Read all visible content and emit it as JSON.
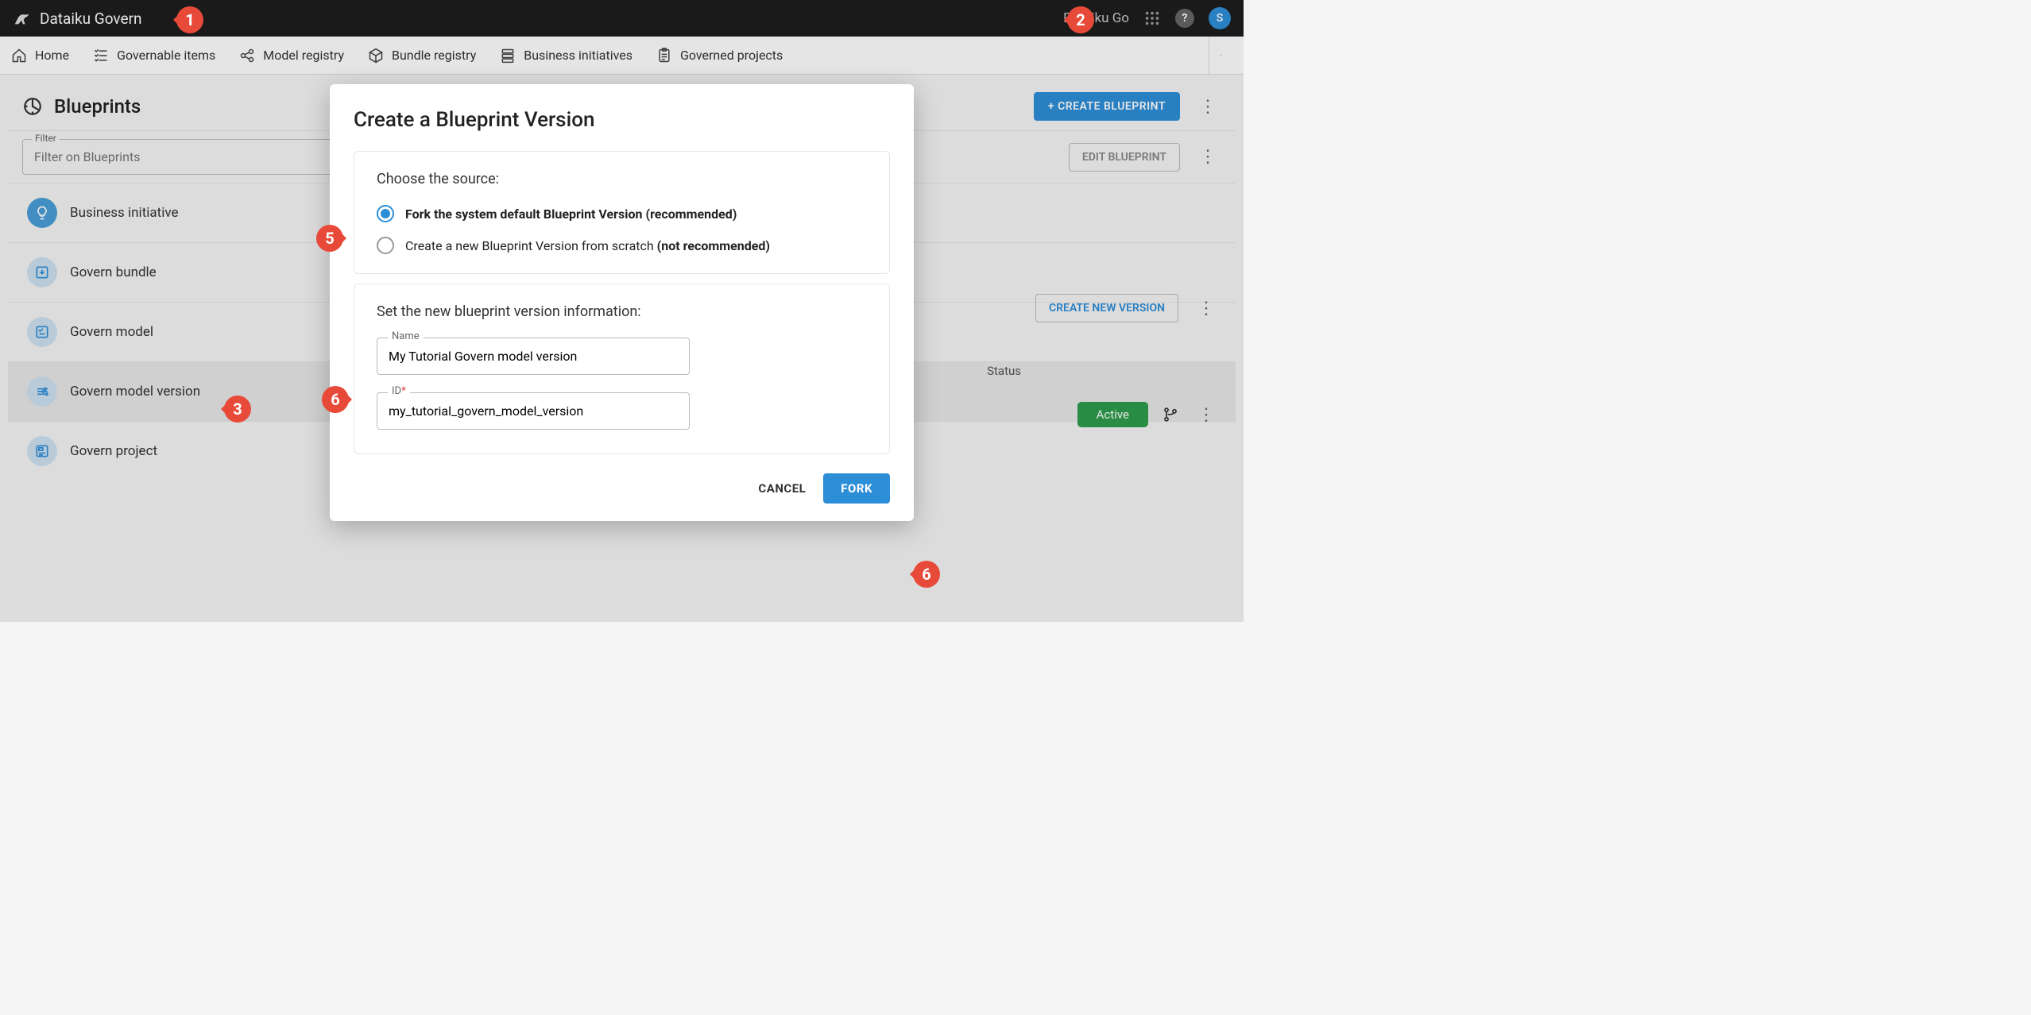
{
  "topbar": {
    "app_title": "Dataiku Govern",
    "tenant": "Dataiku Go",
    "avatar_initial": "S"
  },
  "nav": {
    "items": [
      {
        "label": "Home"
      },
      {
        "label": "Governable items"
      },
      {
        "label": "Model registry"
      },
      {
        "label": "Bundle registry"
      },
      {
        "label": "Business initiatives"
      },
      {
        "label": "Governed projects"
      }
    ]
  },
  "page": {
    "title": "Blueprints",
    "create_btn": "+ CREATE BLUEPRINT",
    "filter_label": "Filter",
    "filter_placeholder": "Filter on Blueprints",
    "edit_btn": "EDIT BLUEPRINT",
    "create_version_btn": "CREATE NEW VERSION",
    "status_header": "Status",
    "status_value": "Active"
  },
  "blueprints": [
    {
      "name": "Business initiative"
    },
    {
      "name": "Govern bundle"
    },
    {
      "name": "Govern model"
    },
    {
      "name": "Govern model version"
    },
    {
      "name": "Govern project"
    }
  ],
  "modal": {
    "title": "Create a Blueprint Version",
    "source_title": "Choose the source:",
    "option_fork_pre": "Fork the system default Blueprint Version ",
    "option_fork_bold": "(recommended)",
    "option_scratch_pre": "Create a new Blueprint Version from scratch ",
    "option_scratch_bold": "(not recommended)",
    "info_title": "Set the new blueprint version information:",
    "name_label": "Name",
    "name_value": "My Tutorial Govern model version",
    "id_label": "ID",
    "id_value": "my_tutorial_govern_model_version",
    "cancel": "CANCEL",
    "fork": "FORK"
  },
  "callouts": {
    "c1": "1",
    "c2": "2",
    "c3": "3",
    "c5": "5",
    "c6a": "6",
    "c6b": "6"
  }
}
